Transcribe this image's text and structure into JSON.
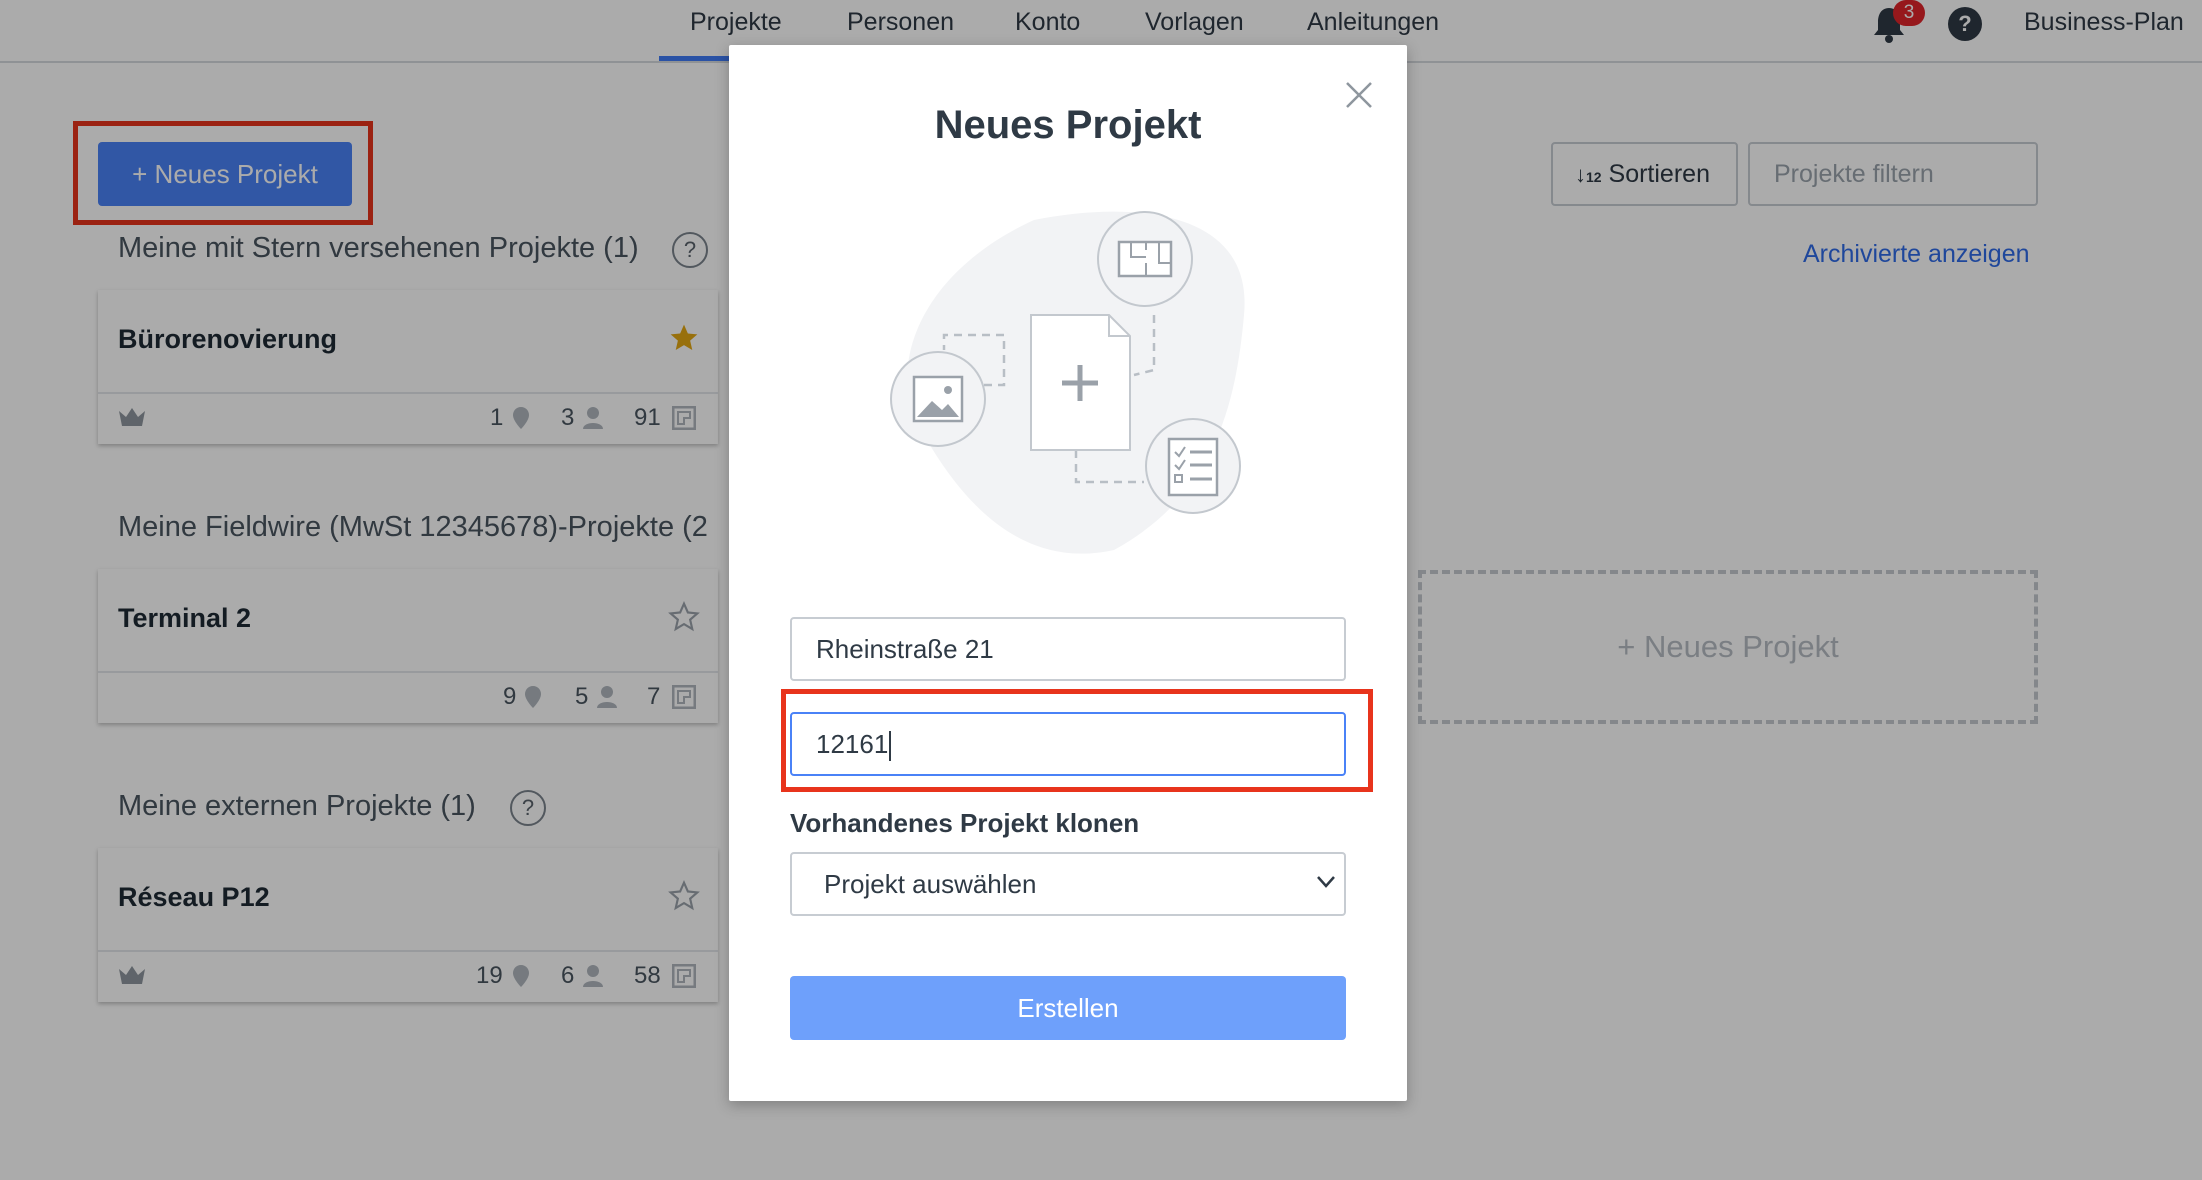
{
  "nav": {
    "items": [
      "Projekte",
      "Personen",
      "Konto",
      "Vorlagen",
      "Anleitungen"
    ],
    "active": "Projekte",
    "notification_count": "3",
    "help": "?",
    "plan": "Business-Plan"
  },
  "toolbar": {
    "new_project_label": "+ Neues Projekt",
    "sort_label": "Sortieren",
    "filter_placeholder": "Projekte filtern",
    "archived_link": "Archivierte anzeigen"
  },
  "sections": [
    {
      "title": "Meine mit Stern versehenen Projekte (1)",
      "help": "?",
      "projects": [
        {
          "name": "Bürorenovierung",
          "starred": true,
          "owner_crown": true,
          "pins": "1",
          "people": "3",
          "plans": "91"
        }
      ]
    },
    {
      "title": "Meine Fieldwire (MwSt 12345678)-Projekte (2",
      "help": "",
      "projects": [
        {
          "name": "Terminal 2",
          "starred": false,
          "owner_crown": false,
          "pins": "9",
          "people": "5",
          "plans": "7"
        }
      ]
    },
    {
      "title": "Meine externen Projekte (1)",
      "help": "?",
      "projects": [
        {
          "name": "Réseau P12",
          "starred": false,
          "owner_crown": true,
          "pins": "19",
          "people": "6",
          "plans": "58"
        }
      ]
    }
  ],
  "placeholder_card": "+ Neues Projekt",
  "modal": {
    "title": "Neues Projekt",
    "name_value": "Rheinstraße 21",
    "code_value": "12161",
    "clone_label": "Vorhandenes Projekt klonen",
    "clone_select": "Projekt auswählen",
    "create_label": "Erstellen"
  },
  "colors": {
    "accent": "#4a82f7",
    "highlight": "#e8341c",
    "star_gold": "#e3a812",
    "badge_red": "#e0252b"
  }
}
